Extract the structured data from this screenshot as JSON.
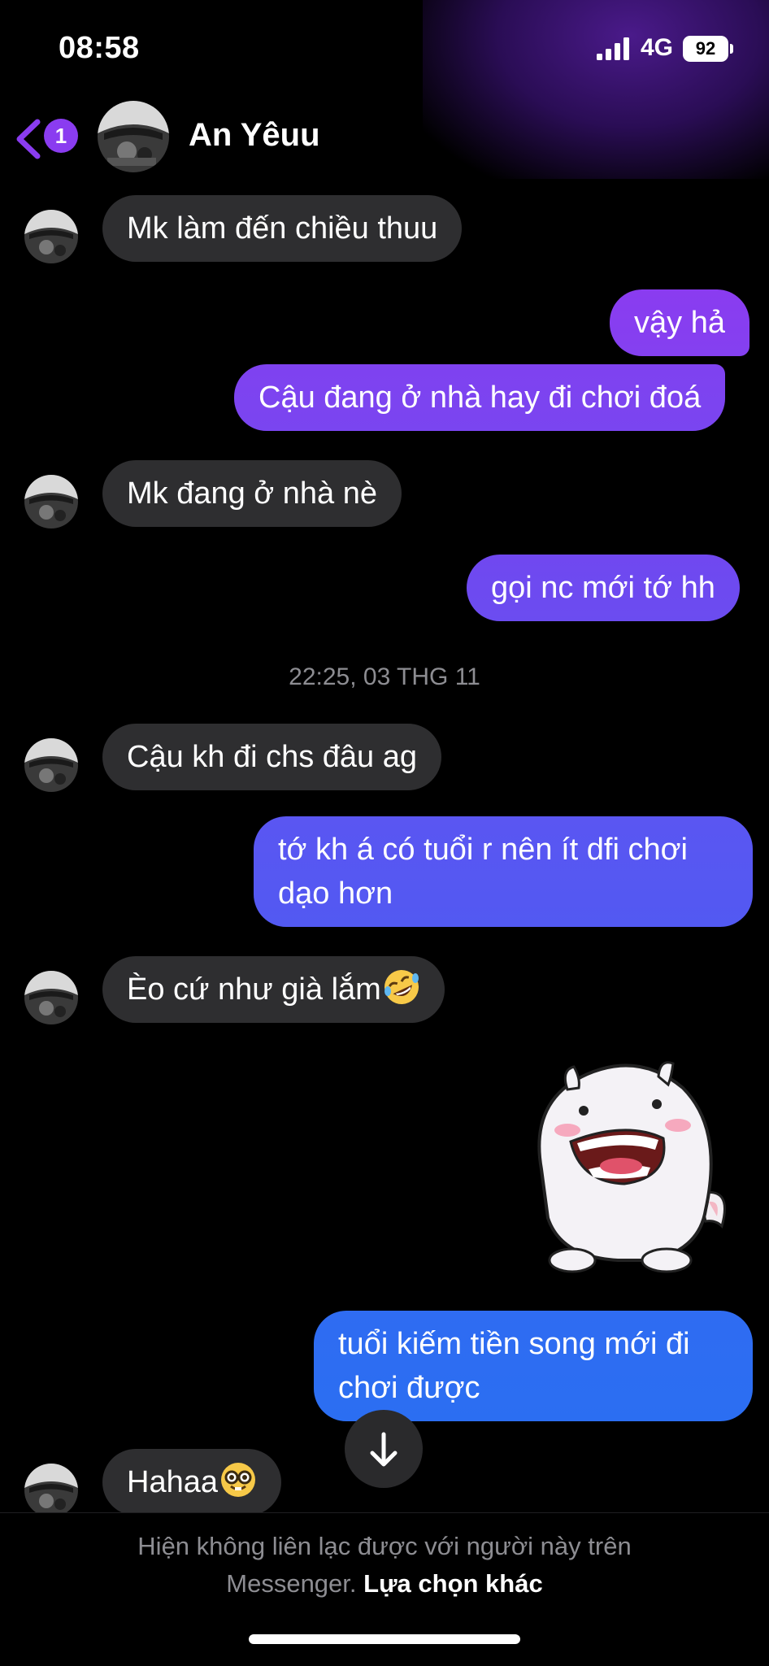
{
  "status_bar": {
    "time": "08:58",
    "network": "4G",
    "battery": "92"
  },
  "header": {
    "back_count": "1",
    "contact_name": "An Yêuu"
  },
  "messages": [
    {
      "from": "them",
      "text": "Mk làm đến chiều thuu"
    },
    {
      "from": "me",
      "text": "vậy hả"
    },
    {
      "from": "me",
      "text": "Cậu đang ở nhà hay đi chơi đoá"
    },
    {
      "from": "them",
      "text": "Mk đang ở nhà nè"
    },
    {
      "from": "me",
      "text": "gọi nc mới tớ hh"
    },
    {
      "from": "them",
      "text": "Cậu kh đi chs đâu ag"
    },
    {
      "from": "me",
      "text_line1": "tớ kh á có tuổi r nên ít dfi chơi",
      "text_line2": "dạo hơn"
    },
    {
      "from": "them",
      "text": "Èo cứ như già lắm",
      "emoji": "rolling-laughing-emoji"
    },
    {
      "from": "me",
      "type": "sticker",
      "sticker": "white-creature-laughing-sticker"
    },
    {
      "from": "me",
      "text_line1": "tuổi kiếm tiền song mới đi",
      "text_line2": "chơi được"
    },
    {
      "from": "them",
      "text": "Hahaa",
      "emoji": "nerd-face-emoji"
    }
  ],
  "timestamp": "22:25, 03 THG 11",
  "footer": {
    "line1": "Hiện không liên lạc được với người này trên",
    "line2_prefix": "Messenger.",
    "link": "Lựa chọn khác"
  },
  "colors": {
    "accent_purple": "#8a3cf0",
    "bubble_gradient_top": "#8a3cf0",
    "bubble_gradient_bottom": "#2e6bf2",
    "incoming_bubble": "#2e2e30",
    "background": "#000000"
  }
}
